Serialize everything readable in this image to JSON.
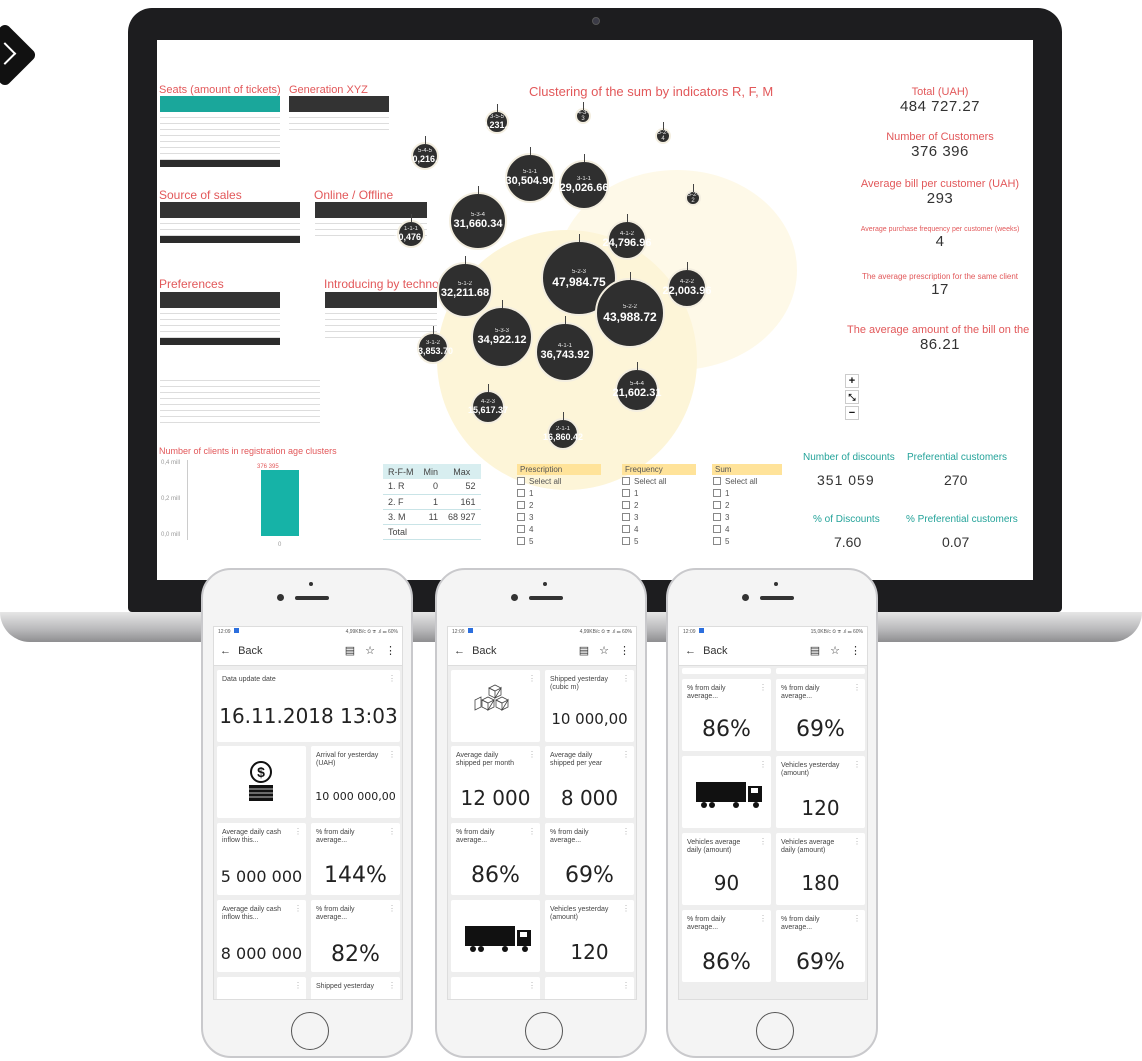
{
  "dashboard": {
    "tables": {
      "seats_title": "Seats (amount of tickets)",
      "generation_title": "Generation XYZ",
      "source_title": "Source of sales",
      "online_title": "Online / Offline",
      "preferences_title": "Preferences",
      "technology_title": "Introducing by technology"
    },
    "bar_chart": {
      "title": "Number of clients in registration age clusters",
      "y_ticks": [
        "0,4 mill",
        "0,2 mill",
        "0,0 mill"
      ],
      "bar_label": "376 395",
      "x_label": "0"
    },
    "cluster": {
      "title": "Clustering of the sum by indicators R, F, M",
      "bubbles": [
        {
          "code": "5-1-1",
          "value": "30,504.90"
        },
        {
          "code": "3-1-1",
          "value": "29,026.66"
        },
        {
          "code": "5-3-4",
          "value": "31,660.34"
        },
        {
          "code": "5-2-3",
          "value": "47,984.75"
        },
        {
          "code": "5-1-2",
          "value": "32,211.68"
        },
        {
          "code": "4-1-2",
          "value": "24,796.96"
        },
        {
          "code": "5-2-2",
          "value": "43,988.72"
        },
        {
          "code": "4-2-2",
          "value": "22,003.96"
        },
        {
          "code": "5-3-3",
          "value": "34,922.12"
        },
        {
          "code": "4-1-1",
          "value": "36,743.92"
        },
        {
          "code": "5-4-4",
          "value": "21,602.31"
        },
        {
          "code": "3-1-2",
          "value": "13,853.70"
        },
        {
          "code": "4-2-3",
          "value": "15,617.37"
        },
        {
          "code": "2-1-1",
          "value": "16,860.42"
        },
        {
          "code": "1-1-1",
          "value": "10,476..."
        },
        {
          "code": "5-4-5",
          "value": "10,216..."
        },
        {
          "code": "3-5-5",
          "value": "8,231..."
        },
        {
          "code": "4-3-3",
          "value": ""
        },
        {
          "code": "5-2-4",
          "value": ""
        },
        {
          "code": "3-2-2",
          "value": ""
        }
      ],
      "zoom_in": "+",
      "zoom_reset": "⤡",
      "zoom_out": "−"
    },
    "kpis": [
      {
        "label": "Total (UAH)",
        "value": "484 727.27"
      },
      {
        "label": "Number of Customers",
        "value": "376 396"
      },
      {
        "label": "Average bill per customer (UAH)",
        "value": "293"
      },
      {
        "label": "Average purchase frequency per customer (weeks)",
        "value": "4"
      },
      {
        "label": "The average prescription for the same client",
        "value": "17"
      },
      {
        "label": "The average amount of the bill on the bar",
        "value": "86.21"
      }
    ],
    "discounts": {
      "num_label": "Number of discounts",
      "num_value": "351 059",
      "pref_label": "Preferential customers",
      "pref_value": "270",
      "pct_label": "% of Discounts",
      "pct_value": "7.60",
      "pref_pct_label": "% Preferential customers",
      "pref_pct_value": "0.07"
    },
    "rfm_table": {
      "headers": [
        "R-F-M",
        "Min",
        "Max"
      ],
      "rows": [
        [
          "1. R",
          "0",
          "52"
        ],
        [
          "2. F",
          "1",
          "161"
        ],
        [
          "3. M",
          "11",
          "68 927"
        ],
        [
          "Total",
          "",
          ""
        ]
      ]
    },
    "filters": [
      {
        "title": "Prescription",
        "select_all": "Select all",
        "items": [
          "1",
          "2",
          "3",
          "4",
          "5"
        ]
      },
      {
        "title": "Frequency",
        "select_all": "Select all",
        "items": [
          "1",
          "2",
          "3",
          "4",
          "5"
        ]
      },
      {
        "title": "Sum",
        "select_all": "Select all",
        "items": [
          "1",
          "2",
          "3",
          "4",
          "5"
        ]
      }
    ]
  },
  "phones": {
    "status_time": "12:09",
    "status_right_1": "4,99KB/c ⏲ ☏ .ıl ▭ 60%",
    "status_right_3": "15,0KB/c ⏲ ☏ .ıl ▭ 60%",
    "back_label": "Back",
    "comment_icon": "▤",
    "star_icon": "☆",
    "menu_icon": "⋮",
    "phone1": {
      "update_label": "Data update date",
      "update_value": "16.11.2018 13:03",
      "arrival_label": "Arrival for yesterday (UAH)",
      "arrival_value": "10 000 000,00",
      "avg_cash_label_1": "Average daily cash inflow this...",
      "avg_cash_value_1": "5 000 000",
      "pct_label_1": "% from daily average...",
      "pct_value_1": "144%",
      "avg_cash_label_2": "Average daily cash inflow this...",
      "avg_cash_value_2": "8 000 000",
      "pct_label_2": "% from daily average...",
      "pct_value_2": "82%",
      "shipped_label": "Shipped yesterday"
    },
    "phone2": {
      "shipped_label": "Shipped yesterday (cubic m)",
      "shipped_value": "10 000,00",
      "avg_month_label": "Average daily shipped per month",
      "avg_month_value": "12 000",
      "avg_year_label": "Average daily shipped per year",
      "avg_year_value": "8 000",
      "pct_label_a": "% from daily average...",
      "pct_value_a": "86%",
      "pct_label_b": "% from daily average...",
      "pct_value_b": "69%",
      "vehicles_label": "Vehicles yesterday (amount)",
      "vehicles_value": "120"
    },
    "phone3": {
      "pct_label_a": "% from daily average...",
      "pct_value_a": "86%",
      "pct_label_b": "% from daily average...",
      "pct_value_b": "69%",
      "vehicles_label": "Vehicles yesterday (amount)",
      "vehicles_value": "120",
      "veh_avg_label_a": "Vehicles average daily (amount)",
      "veh_avg_value_a": "90",
      "veh_avg_label_b": "Vehicles average daily (amount)",
      "veh_avg_value_b": "180",
      "pct_label_c": "% from daily average...",
      "pct_value_c": "86%",
      "pct_label_d": "% from daily average...",
      "pct_value_d": "69%"
    }
  }
}
